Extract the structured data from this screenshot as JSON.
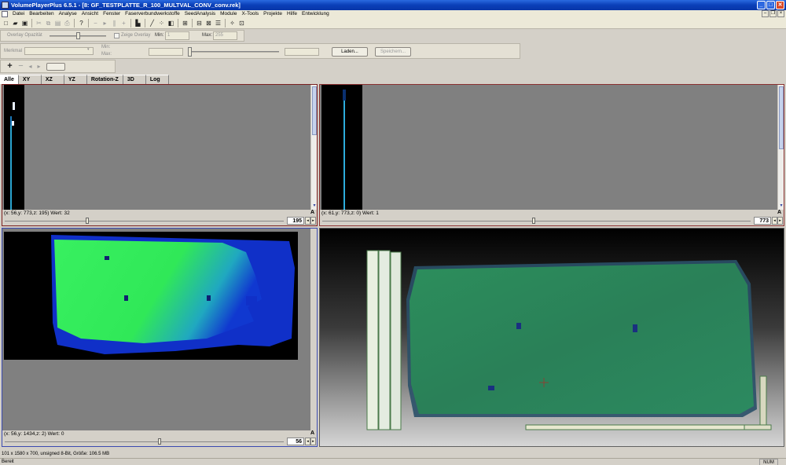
{
  "window": {
    "title": "VolumePlayerPlus 6.5.1 - [8: GF_TESTPLATTE_R_100_MULTVAL_CONV_conv.rek]",
    "controls": [
      "_",
      "□",
      "✕"
    ]
  },
  "menu": [
    "Datei",
    "Bearbeiten",
    "Analyse",
    "Ansicht",
    "Fenster",
    "Faserverbundwerkstoffe",
    "SeedAnalysis",
    "Module",
    "X-Tools",
    "Projekte",
    "Hilfe",
    "Entwicklung"
  ],
  "overlay": {
    "opacity_label": "Overlay Opazität",
    "show_overlay_label": "Zeige Overlay",
    "min_label": "Min:",
    "min_value": "1",
    "max_label": "Max:",
    "max_value": "255"
  },
  "feature": {
    "label": "Merkmal",
    "min_label": "Min:",
    "max_label": "Max:",
    "load_button": "Laden...",
    "save_button": "Speichern..."
  },
  "tabs": [
    "Alle",
    "XY",
    "XZ",
    "YZ",
    "Rotation-Z",
    "3D",
    "Log"
  ],
  "panels": {
    "top_left": {
      "status": "(x: 56,y: 773,z: 195) Wert: 32",
      "slice": "195",
      "slider_value": 0.29
    },
    "top_right": {
      "status": "(x: 61,y: 773,z: 0) Wert: 1",
      "slice": "773",
      "slider_value": 0.49
    },
    "bottom_left": {
      "status": "(x: 56,y: 1434,z: 2) Wert: 0",
      "slice": "56",
      "slider_value": 0.55
    },
    "corner_label": "A"
  },
  "statusbar": {
    "info": "101 x 1580 x 700,   unsigned 8-Bit,   Größe: 106.5 MB",
    "ready": "Bereit",
    "num": "NUM"
  },
  "colors": {
    "title_bar": "#0a3fb8",
    "plate_green": "#30f050",
    "plate_blue": "#1030d0",
    "render_green": "#2a8a5a"
  }
}
